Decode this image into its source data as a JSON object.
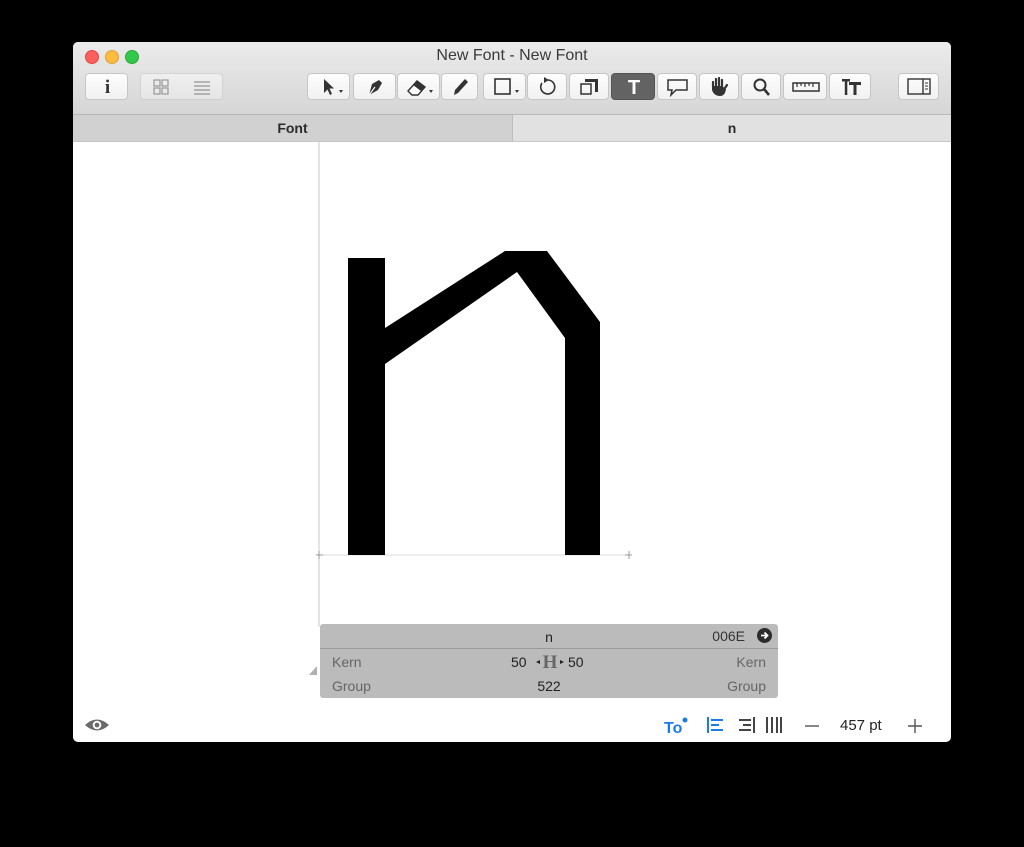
{
  "window": {
    "title": "New Font - New Font"
  },
  "tabs": [
    {
      "label": "Font"
    },
    {
      "label": "n"
    }
  ],
  "info_panel": {
    "glyph_name": "n",
    "unicode": "006E",
    "left_kern_label": "Kern",
    "right_kern_label": "Kern",
    "left_sidebearing": "50",
    "right_sidebearing": "50",
    "left_group_label": "Group",
    "right_group_label": "Group",
    "width": "522"
  },
  "bottom_bar": {
    "zoom": "457 pt"
  },
  "colors": {
    "active_tool": "#636363",
    "accent": "#1c7ce6",
    "panel": "#b2b2b2"
  },
  "icons": [
    "info-icon",
    "grid-view-icon",
    "list-view-icon",
    "select-arrow-icon",
    "pen-icon",
    "eraser-icon",
    "pencil-icon",
    "rectangle-icon",
    "rotate-icon",
    "scale-icon",
    "text-tool-icon",
    "annotation-icon",
    "hand-icon",
    "zoom-icon",
    "ruler-icon",
    "metrics-icon",
    "sidebar-icon",
    "eye-icon"
  ]
}
